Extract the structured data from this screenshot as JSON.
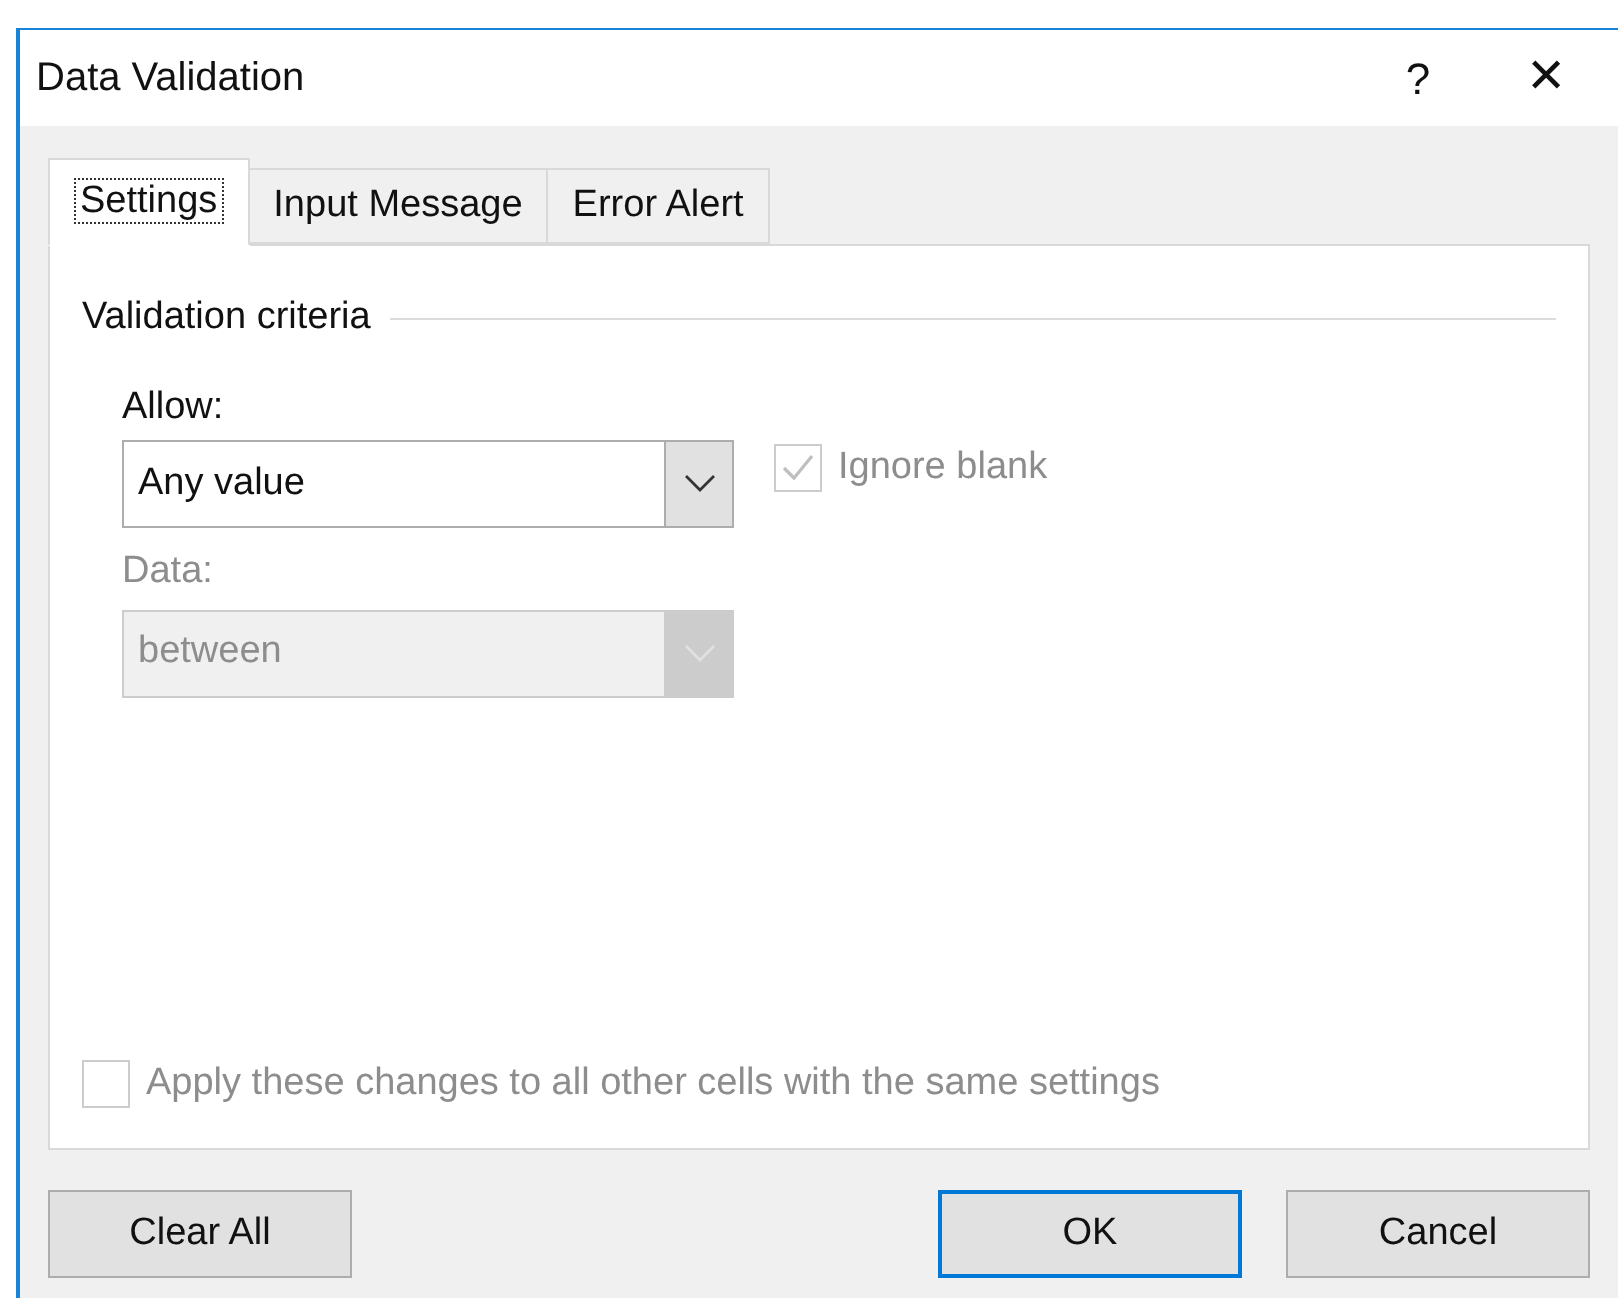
{
  "window": {
    "title": "Data Validation",
    "help": "?",
    "close": "✕"
  },
  "tabs": [
    {
      "label": "Settings",
      "selected": true
    },
    {
      "label": "Input Message",
      "selected": false
    },
    {
      "label": "Error Alert",
      "selected": false
    }
  ],
  "group": {
    "title": "Validation criteria"
  },
  "allow": {
    "label": "Allow:",
    "value": "Any value",
    "disabled": false
  },
  "ignore_blank": {
    "label": "Ignore blank",
    "checked": true,
    "disabled": true
  },
  "data": {
    "label": "Data:",
    "value": "between",
    "disabled": true
  },
  "apply_all": {
    "label": "Apply these changes to all other cells with the same settings",
    "checked": false,
    "disabled": true
  },
  "buttons": [
    {
      "label": "Clear All",
      "default": false
    },
    {
      "label": "OK",
      "default": true
    },
    {
      "label": "Cancel",
      "default": false
    }
  ]
}
